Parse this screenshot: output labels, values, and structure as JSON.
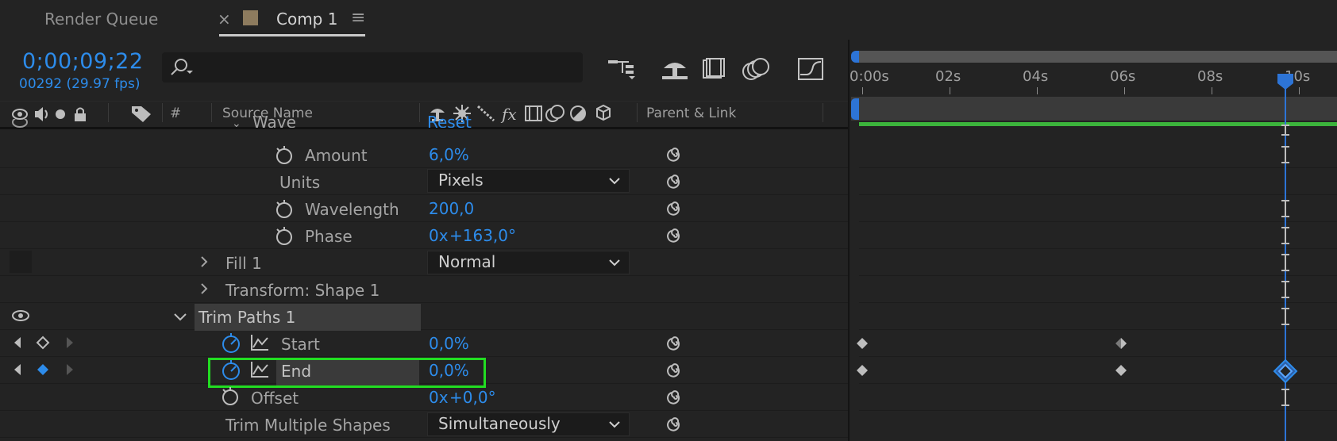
{
  "tabs": {
    "render_queue": "Render Queue",
    "close_glyph": "×",
    "comp": "Comp 1",
    "menu_glyph": "≡"
  },
  "comp": {
    "timecode": "0;00;09;22",
    "frame_info": "00292 (29.97 fps)"
  },
  "search": {
    "placeholder": ""
  },
  "columns": {
    "number": "#",
    "source_name": "Source Name",
    "parent_link": "Parent & Link"
  },
  "rows": {
    "wave": {
      "label": "Wave",
      "value": "Reset"
    },
    "amount": {
      "label": "Amount",
      "value": "6,0%"
    },
    "units": {
      "label": "Units",
      "value": "Pixels"
    },
    "wavelength": {
      "label": "Wavelength",
      "value": "200,0"
    },
    "phase": {
      "label": "Phase",
      "value_prefix": "0x",
      "value": "+163,0°"
    },
    "fill": {
      "label": "Fill 1",
      "value": "Normal"
    },
    "transform": {
      "label": "Transform: Shape 1"
    },
    "trim": {
      "label": "Trim Paths 1"
    },
    "start": {
      "label": "Start",
      "value": "0,0%"
    },
    "end": {
      "label": "End",
      "value": "0,0%"
    },
    "offset": {
      "label": "Offset",
      "value_prefix": "0x",
      "value": "+0,0°"
    },
    "trim_multiple": {
      "label": "Trim Multiple Shapes",
      "value": "Simultaneously"
    }
  },
  "ruler": [
    "0:00s",
    "02s",
    "04s",
    "06s",
    "08s",
    "10s"
  ],
  "colors": {
    "accent_blue": "#2d8ceb",
    "highlight_green": "#22dd22",
    "work_area_green": "#3cb43c"
  }
}
